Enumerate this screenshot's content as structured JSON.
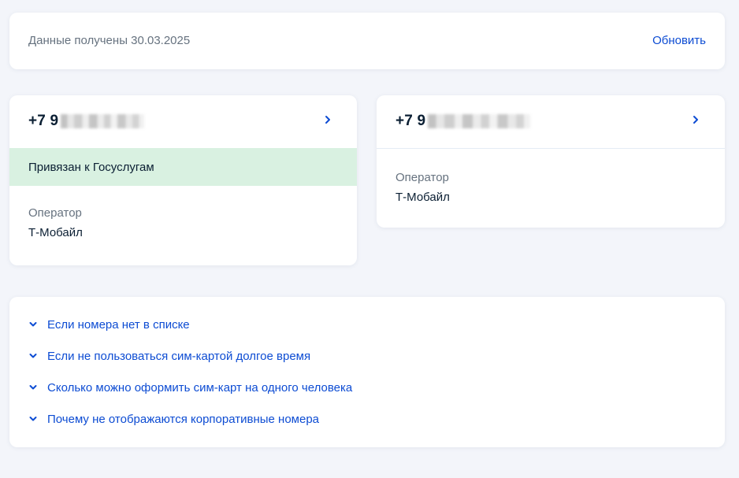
{
  "status": {
    "text": "Данные получены 30.03.2025",
    "refresh_label": "Обновить"
  },
  "phones": [
    {
      "number_prefix": "+7 9",
      "linked_label": "Привязан к Госуслугам",
      "operator_label": "Оператор",
      "operator_value": "Т-Мобайл"
    },
    {
      "number_prefix": "+7 9",
      "operator_label": "Оператор",
      "operator_value": "Т-Мобайл"
    }
  ],
  "faq": [
    {
      "label": "Если номера нет в списке"
    },
    {
      "label": "Если не пользоваться сим-картой долгое время"
    },
    {
      "label": "Сколько можно оформить сим-карт на одного человека"
    },
    {
      "label": "Почему не отображаются корпоративные номера"
    }
  ],
  "icons": {
    "chevron_right": "chevron-right-icon",
    "chevron_down": "chevron-down-icon"
  },
  "colors": {
    "link": "#0d4cd3",
    "linked_banner": "#d9f1e1",
    "secondary_text": "#66727f",
    "background": "#f3f5fa"
  }
}
